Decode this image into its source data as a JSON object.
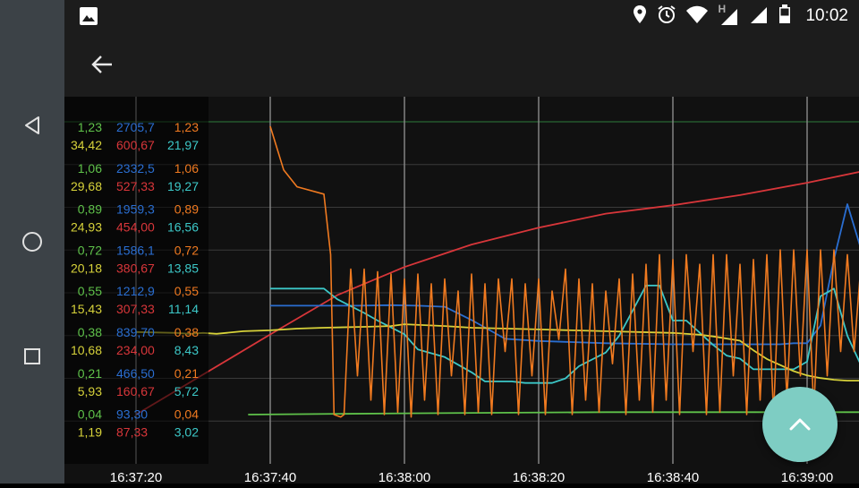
{
  "status_bar": {
    "time": "10:02",
    "network_letter": "H",
    "icons": [
      "image-icon",
      "location-icon",
      "alarm-icon",
      "wifi-icon",
      "signal-icon",
      "signal-icon",
      "battery-icon"
    ]
  },
  "app_bar": {
    "back_icon": "arrow-back-icon"
  },
  "nav_bar": {
    "icons": [
      "back-triangle-icon",
      "home-circle-icon",
      "recents-square-icon"
    ]
  },
  "fab": {
    "icon": "chevron-up-icon",
    "color": "#7ecdc3"
  },
  "colors": {
    "green": "#5fc24a",
    "yellow": "#d7d23a",
    "blue": "#2a6ed1",
    "red": "#d8363a",
    "orange": "#f07a20",
    "cyan": "#3cc8c8"
  },
  "chart_data": {
    "type": "line",
    "x_ticks": [
      "16:37:20",
      "16:37:40",
      "16:38:00",
      "16:38:20",
      "16:38:40",
      "16:39:00"
    ],
    "scale_rows": [
      [
        "1,23",
        "2705,7",
        "1,23"
      ],
      [
        "34,42",
        "600,67",
        "21,97"
      ],
      [
        "1,06",
        "2332,5",
        "1,06"
      ],
      [
        "29,68",
        "527,33",
        "19,27"
      ],
      [
        "0,89",
        "1959,3",
        "0,89"
      ],
      [
        "24,93",
        "454,00",
        "16,56"
      ],
      [
        "0,72",
        "1586,1",
        "0,72"
      ],
      [
        "20,18",
        "380,67",
        "13,85"
      ],
      [
        "0,55",
        "1212,9",
        "0,55"
      ],
      [
        "15,43",
        "307,33",
        "11,14"
      ],
      [
        "0,38",
        "839,70",
        "0,38"
      ],
      [
        "10,68",
        "234,00",
        "8,43"
      ],
      [
        "0,21",
        "466,50",
        "0,21"
      ],
      [
        "5,93",
        "160,67",
        "5,72"
      ],
      [
        "0,04",
        "93,30",
        "0,04"
      ],
      [
        "1,19",
        "87,33",
        "3,02"
      ]
    ],
    "row_colors": [
      [
        "green",
        "blue",
        "orange"
      ],
      [
        "yellow",
        "red",
        "cyan"
      ]
    ],
    "grid": true,
    "series": [
      {
        "color": "green",
        "x": [
          16.7,
          40,
          70,
          100,
          140
        ],
        "y": [
          0.04,
          0.045,
          0.05,
          0.05,
          0.05
        ]
      },
      {
        "color": "red",
        "x": [
          0,
          20,
          30,
          40,
          50,
          60,
          70,
          80,
          90,
          100,
          110,
          115
        ],
        "y": [
          87.33,
          230,
          300,
          350,
          390,
          420,
          445,
          460,
          478,
          500,
          525,
          528
        ]
      },
      {
        "color": "blue",
        "x": [
          20,
          30,
          33,
          38,
          42,
          46,
          50,
          55,
          60,
          70,
          80,
          90,
          96,
          98,
          100,
          102,
          104,
          106,
          108,
          110,
          112,
          115
        ],
        "y": [
          1080,
          1080,
          1080,
          1085,
          1080,
          1070,
          950,
          780,
          760,
          740,
          730,
          730,
          730,
          740,
          740,
          900,
          1500,
          2000,
          1600,
          1450,
          1500,
          1480
        ]
      },
      {
        "color": "cyan",
        "x": [
          20,
          28,
          30,
          34,
          36,
          40,
          42,
          46,
          50,
          52,
          56,
          58,
          62,
          64,
          66,
          70,
          72,
          76,
          78,
          80,
          82,
          86,
          88,
          90,
          92,
          94,
          96,
          98,
          100,
          102,
          104,
          106,
          108,
          110,
          112,
          115
        ],
        "y": [
          11.3,
          11.3,
          10.6,
          9.7,
          9.2,
          8.3,
          7.3,
          6.8,
          5.8,
          5.2,
          5.2,
          5.1,
          5.1,
          5.4,
          6.2,
          7.1,
          8.2,
          11.5,
          11.5,
          9.2,
          9.2,
          7.6,
          6.9,
          6.7,
          6.0,
          6.0,
          6.0,
          6.0,
          6.5,
          10.8,
          11.3,
          8.2,
          6.3,
          7.5,
          5.9,
          5.9
        ]
      },
      {
        "color": "yellow",
        "x": [
          0,
          6,
          8,
          10,
          12,
          16,
          20,
          24,
          28,
          34,
          38,
          40,
          46,
          50,
          60,
          70,
          80,
          84,
          86,
          90,
          92,
          94,
          96,
          98,
          100,
          102,
          104,
          106,
          108,
          110,
          112,
          115
        ],
        "y": [
          10.7,
          10.6,
          10.5,
          10.6,
          10.5,
          10.8,
          10.9,
          11.1,
          11.2,
          11.3,
          11.4,
          11.6,
          11.4,
          11.2,
          11.0,
          10.8,
          10.6,
          10.4,
          10.2,
          9.7,
          8.6,
          7.6,
          6.9,
          6.2,
          5.7,
          5.4,
          5.2,
          5.1,
          5.1,
          5.1,
          5.1,
          5.1
        ]
      },
      {
        "color": "orange",
        "x": [
          20,
          22,
          24,
          28,
          29,
          29.5,
          30.5,
          31,
          32,
          33,
          34,
          35,
          36,
          37,
          38,
          39,
          40,
          41,
          42,
          43,
          44,
          45,
          46,
          47,
          48,
          49,
          50,
          51,
          52,
          53,
          54,
          55,
          56,
          57,
          58,
          59,
          60,
          61,
          62,
          63,
          64,
          65,
          66,
          67,
          68,
          69,
          70,
          71,
          72,
          73,
          74,
          75,
          76,
          77,
          78,
          79,
          80,
          81,
          82,
          83,
          84,
          85,
          86,
          87,
          88,
          89,
          90,
          91,
          92,
          93,
          94,
          95,
          96,
          97,
          98,
          99,
          100,
          101,
          102,
          103,
          104,
          105,
          106,
          107,
          108,
          109,
          110,
          111,
          112,
          113,
          114,
          115
        ],
        "y": [
          1.23,
          1.05,
          0.98,
          0.95,
          0.7,
          0.04,
          0.03,
          0.04,
          0.64,
          0.2,
          0.64,
          0.1,
          0.63,
          0.04,
          0.62,
          0.05,
          0.6,
          0.03,
          0.62,
          0.1,
          0.58,
          0.04,
          0.6,
          0.2,
          0.55,
          0.04,
          0.62,
          0.05,
          0.58,
          0.04,
          0.6,
          0.3,
          0.6,
          0.04,
          0.58,
          0.2,
          0.6,
          0.04,
          0.55,
          0.35,
          0.64,
          0.04,
          0.6,
          0.1,
          0.58,
          0.05,
          0.55,
          0.25,
          0.6,
          0.04,
          0.62,
          0.1,
          0.66,
          0.05,
          0.7,
          0.1,
          0.68,
          0.04,
          0.7,
          0.3,
          0.66,
          0.04,
          0.7,
          0.05,
          0.7,
          0.2,
          0.66,
          0.04,
          0.68,
          0.1,
          0.7,
          0.04,
          0.72,
          0.1,
          0.72,
          0.2,
          0.72,
          0.05,
          0.72,
          0.2,
          0.72,
          0.3,
          0.7,
          0.3,
          0.65,
          0.1,
          0.72,
          0.3,
          0.7,
          0.05,
          0.68,
          0.1
        ]
      }
    ]
  }
}
